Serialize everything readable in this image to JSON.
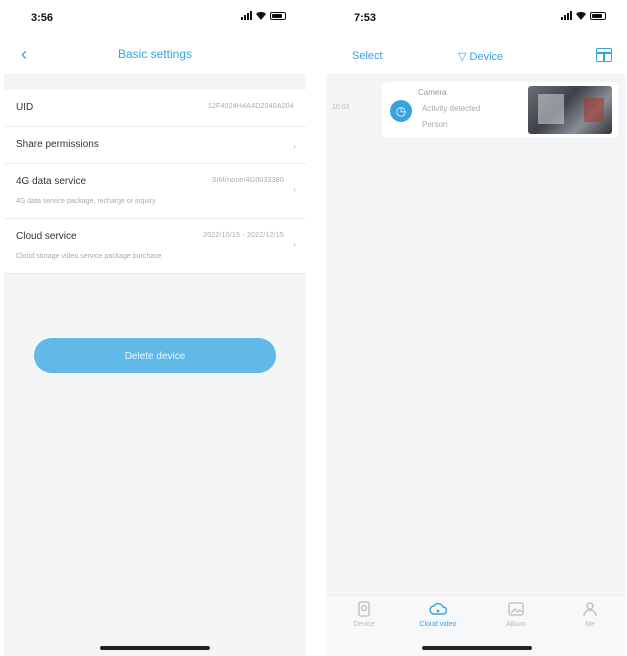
{
  "left_screen": {
    "status_time": "3:56",
    "nav": {
      "title": "Basic settings"
    },
    "rows": [
      {
        "label": "UID",
        "value": "12F4024H4A4D2040A204"
      },
      {
        "label": "Share permissions",
        "value": ""
      },
      {
        "label": "4G data service",
        "value": "SIM/none/4G0033380",
        "desc": "4G data service package, recharge or inquiry"
      },
      {
        "label": "Cloud service",
        "value": "2022/10/15 - 2022/12/15",
        "desc": "Cloud storage video service package purchase"
      }
    ],
    "delete_button_label": "Delete device"
  },
  "right_screen": {
    "status_time": "7:53",
    "nav": {
      "select_label": "Select",
      "filter_label": "▽ Device"
    },
    "event": {
      "time": "10:03",
      "line1": "Camera",
      "line2": "Activity detected",
      "line3": "Person"
    },
    "tabs": [
      {
        "label": "Device",
        "icon": "device-icon",
        "active": false
      },
      {
        "label": "Cloud video",
        "icon": "cloud-icon",
        "active": true
      },
      {
        "label": "Album",
        "icon": "album-icon",
        "active": false
      },
      {
        "label": "Me",
        "icon": "profile-icon",
        "active": false
      }
    ]
  },
  "colors": {
    "accent": "#37a3de",
    "button": "#61b9e8",
    "background": "#f4f5f7"
  }
}
